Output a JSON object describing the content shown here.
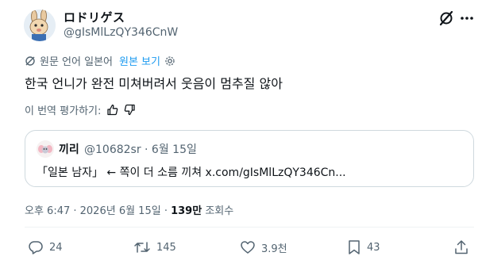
{
  "author": {
    "display_name": "ロドリゲス",
    "handle": "@gIsMlLzQY346CnW"
  },
  "icons": {
    "grok": "grok-icon",
    "more": "more-icon",
    "translate": "translate-icon",
    "settings": "gear-icon",
    "thumbs_up": "thumbs-up-icon",
    "thumbs_down": "thumbs-down-icon"
  },
  "translation": {
    "original_language_label": "원문 언어 일본어",
    "show_original_link": "원본 보기",
    "rate_label": "이 번역 평가하기:"
  },
  "tweet": {
    "text": "한국 언니가 완전 미쳐버려서 웃음이 멈추질 않아"
  },
  "quote": {
    "display_name": "끼리",
    "meta": "@10682sr · 6월 15일",
    "text": "「일본 남자」 ← 쪽이 더 소름 끼쳐 x.com/gIsMlLzQY346Cn..."
  },
  "timestamp": {
    "time_date": "오후 6:47 · 2026년 6월 15일 · ",
    "views_count": "139만",
    "views_label": " 조회수"
  },
  "actions": {
    "replies": "24",
    "reposts": "145",
    "likes": "3.9천",
    "bookmarks": "43"
  },
  "colors": {
    "text": "#0f1419",
    "muted": "#536471",
    "link": "#1d9bf0",
    "border": "#cfd9de"
  }
}
